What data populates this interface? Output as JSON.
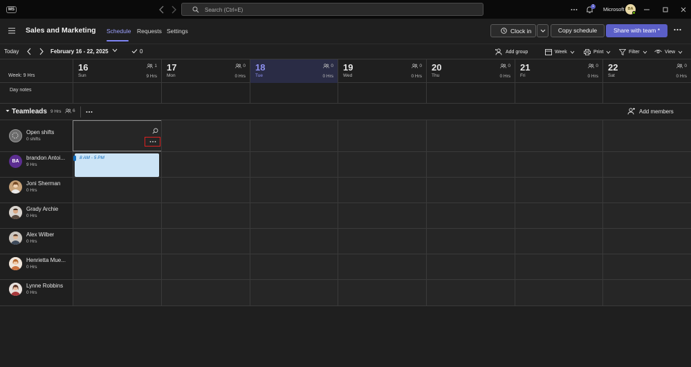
{
  "titlebar": {
    "app_badge": "MS",
    "search_placeholder": "Search (Ctrl+E)",
    "notification_count": "1",
    "org_name": "Microsoft",
    "user_initials": "BA"
  },
  "header": {
    "team_name": "Sales and Marketing",
    "tabs": [
      {
        "label": "Schedule",
        "active": true
      },
      {
        "label": "Requests"
      },
      {
        "label": "Settings"
      }
    ],
    "clock_in_label": "Clock in",
    "copy_schedule_label": "Copy schedule",
    "share_label": "Share with team *"
  },
  "toolbar": {
    "today_label": "Today",
    "date_range": "February 16 - 22, 2025",
    "check_count": "0",
    "add_group_label": "Add group",
    "week_label": "Week",
    "print_label": "Print",
    "filter_label": "Filter",
    "view_label": "View"
  },
  "week_summary": "Week: 9 Hrs",
  "days": [
    {
      "num": "16",
      "name": "Sun",
      "people": "1",
      "hrs": "9 Hrs"
    },
    {
      "num": "17",
      "name": "Mon",
      "people": "0",
      "hrs": "0 Hrs"
    },
    {
      "num": "18",
      "name": "Tue",
      "people": "0",
      "hrs": "0 Hrs",
      "today": true
    },
    {
      "num": "19",
      "name": "Wed",
      "people": "0",
      "hrs": "0 Hrs"
    },
    {
      "num": "20",
      "name": "Thu",
      "people": "0",
      "hrs": "0 Hrs"
    },
    {
      "num": "21",
      "name": "Fri",
      "people": "0",
      "hrs": "0 Hrs"
    },
    {
      "num": "22",
      "name": "Sat",
      "people": "0",
      "hrs": "0 Hrs"
    }
  ],
  "day_notes_label": "Day notes",
  "group": {
    "name": "Teamleads",
    "hrs": "9 Hrs",
    "people": "6",
    "add_members_label": "Add members"
  },
  "open_shifts": {
    "name": "Open shifts",
    "sub": "0 shifts"
  },
  "members": [
    {
      "name": "brandon Antoi...",
      "sub": "9 Hrs",
      "initials": "BA",
      "avatar_color": "#5c2e91"
    },
    {
      "name": "Joni Sherman",
      "sub": "0 Hrs",
      "avatar_color": "#c8a37a"
    },
    {
      "name": "Grady Archie",
      "sub": "0 Hrs",
      "avatar_color": "#a0745a"
    },
    {
      "name": "Alex Wilber",
      "sub": "0 Hrs",
      "avatar_color": "#8d7b6a"
    },
    {
      "name": "Henrietta Mue...",
      "sub": "0 Hrs",
      "avatar_color": "#d9a67e"
    },
    {
      "name": "Lynne Robbins",
      "sub": "0 Hrs",
      "avatar_color": "#b5696a"
    }
  ],
  "shift": {
    "time": "8 AM - 5 PM",
    "accent": "#0f6cbd",
    "fill": "#cce4f6"
  },
  "colors": {
    "brand": "#5b5fc7",
    "highlight": "#e02020"
  }
}
